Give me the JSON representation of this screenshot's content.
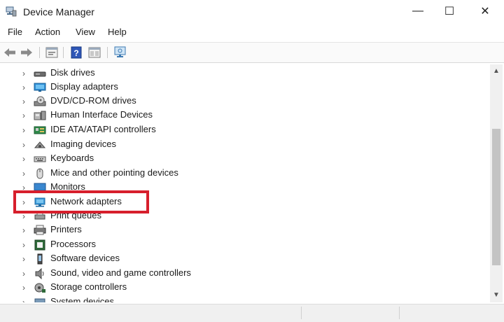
{
  "window": {
    "title": "Device Manager",
    "min_glyph": "—",
    "max_glyph": "☐",
    "close_glyph": "✕"
  },
  "menu": {
    "items": [
      "File",
      "Action",
      "View",
      "Help"
    ]
  },
  "toolbar": {
    "buttons": [
      "back-arrow-icon",
      "forward-arrow-icon",
      "properties-icon",
      "help-icon",
      "show-hidden-icon",
      "scan-hardware-icon"
    ]
  },
  "tree": {
    "items": [
      {
        "label": "Disk drives",
        "icon": "disk-drive-icon"
      },
      {
        "label": "Display adapters",
        "icon": "display-adapter-icon"
      },
      {
        "label": "DVD/CD-ROM drives",
        "icon": "dvd-drive-icon"
      },
      {
        "label": "Human Interface Devices",
        "icon": "hid-icon"
      },
      {
        "label": "IDE ATA/ATAPI controllers",
        "icon": "ide-controller-icon"
      },
      {
        "label": "Imaging devices",
        "icon": "camera-icon"
      },
      {
        "label": "Keyboards",
        "icon": "keyboard-icon"
      },
      {
        "label": "Mice and other pointing devices",
        "icon": "mouse-icon"
      },
      {
        "label": "Monitors",
        "icon": "monitor-icon"
      },
      {
        "label": "Network adapters",
        "icon": "network-adapter-icon"
      },
      {
        "label": "Print queues",
        "icon": "print-queue-icon"
      },
      {
        "label": "Printers",
        "icon": "printer-icon"
      },
      {
        "label": "Processors",
        "icon": "processor-icon"
      },
      {
        "label": "Software devices",
        "icon": "software-device-icon"
      },
      {
        "label": "Sound, video and game controllers",
        "icon": "speaker-icon"
      },
      {
        "label": "Storage controllers",
        "icon": "storage-controller-icon"
      },
      {
        "label": "System devices",
        "icon": "system-device-icon"
      }
    ],
    "expand_glyph": "›"
  },
  "highlight": {
    "target": "Network adapters",
    "color": "#d71f2c"
  },
  "scrollbar": {
    "up_glyph": "▲",
    "down_glyph": "▼"
  }
}
